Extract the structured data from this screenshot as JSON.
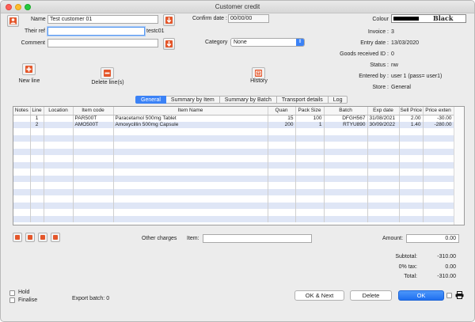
{
  "window": {
    "title": "Customer credit"
  },
  "header": {
    "name_label": "Name",
    "name_value": "Test customer 01",
    "their_ref_label": "Their ref",
    "their_ref_value": "",
    "their_ref_code": "testc01",
    "comment_label": "Comment",
    "comment_value": "",
    "confirm_date_label": "Confirm date :",
    "confirm_date_value": "00/00/00",
    "category_label": "Category",
    "category_value": "None",
    "colour_label": "Colour",
    "colour_name": "Black",
    "colour_hex": "#000000",
    "invoice_label": "Invoice :",
    "invoice_value": "3",
    "entry_date_label": "Entry date :",
    "entry_date_value": "13/03/2020",
    "goods_received_label": "Goods received ID :",
    "goods_received_value": "0",
    "status_label": "Status :",
    "status_value": "nw",
    "entered_by_label": "Entered by :",
    "entered_by_value": "user 1 (pass= user1)",
    "store_label": "Store :",
    "store_value": "General"
  },
  "actions": {
    "new_line": "New line",
    "delete_lines": "Delete line(s)",
    "history": "History"
  },
  "tabs": [
    {
      "label": "General",
      "active": true
    },
    {
      "label": "Summary by Item",
      "active": false
    },
    {
      "label": "Summary by Batch",
      "active": false
    },
    {
      "label": "Transport details",
      "active": false
    },
    {
      "label": "Log",
      "active": false
    }
  ],
  "table": {
    "columns": [
      "Notes",
      "Line",
      "Location",
      "Item code",
      "Item Name",
      "Quan",
      "Pack Size",
      "Batch",
      "Exp date",
      "Sell Price",
      "Price exten"
    ],
    "rows": [
      [
        "",
        "1",
        "",
        "PAR500T",
        "Paracetamol 500mg Tablet",
        "15",
        "100",
        "DFGH567",
        "31/08/2021",
        "2.00",
        "-30.00"
      ],
      [
        "",
        "2",
        "",
        "AMO500T",
        "Amoxycillin 500mg Capsule",
        "200",
        "1",
        "RTYU890",
        "30/09/2022",
        "1.40",
        "-280.00"
      ]
    ]
  },
  "footer": {
    "other_charges_label": "Other charges",
    "item_label": "Item:",
    "item_value": "",
    "amount_label": "Amount:",
    "amount_value": "0.00",
    "subtotal_label": "Subtotal:",
    "subtotal_value": "-310.00",
    "tax_label": "0% tax:",
    "tax_value": "0.00",
    "total_label": "Total:",
    "total_value": "-310.00",
    "hold_label": "Hold",
    "finalise_label": "Finalise",
    "export_batch": "Export batch: 0",
    "ok_next": "OK & Next",
    "delete": "Delete",
    "ok": "OK"
  },
  "icons": {
    "accent": "#e4562a",
    "tab_active": "#3b82f6"
  }
}
